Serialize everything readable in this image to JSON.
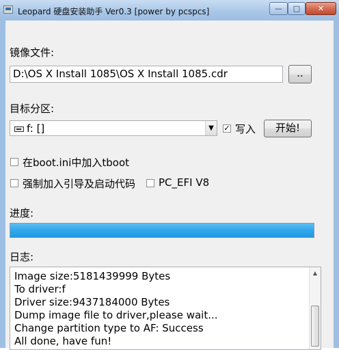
{
  "window": {
    "title": "Leopard 硬盘安装助手 Ver0.3 [power by pcspcs]",
    "minimize_glyph": "—",
    "maximize_glyph": "□",
    "close_glyph": "✕"
  },
  "image_file": {
    "label": "镜像文件:",
    "path": "D:\\OS X Install 1085\\OS X Install 1085.cdr",
    "browse_label": ".."
  },
  "target_partition": {
    "label": "目标分区:",
    "selected": "f: []",
    "write_checkbox": {
      "label": "写入",
      "checked": true
    },
    "start_button": "开始!"
  },
  "options": {
    "tboot": {
      "label": "在boot.ini中加入tboot",
      "checked": false
    },
    "force_boot": {
      "label": "强制加入引导及启动代码",
      "checked": false
    },
    "pc_efi": {
      "label": "PC_EFI V8",
      "checked": false
    }
  },
  "progress": {
    "label": "进度:",
    "value": 100
  },
  "log": {
    "label": "日志:",
    "lines": [
      "Image size:5181439999 Bytes",
      "To driver:f",
      "Driver size:9437184000 Bytes",
      "Dump image file to driver,please wait...",
      "Change partition type to AF: Success",
      "All done, have fun!"
    ]
  },
  "colors": {
    "progress_fill": "#32a8ec",
    "close_button": "#c24a30"
  }
}
